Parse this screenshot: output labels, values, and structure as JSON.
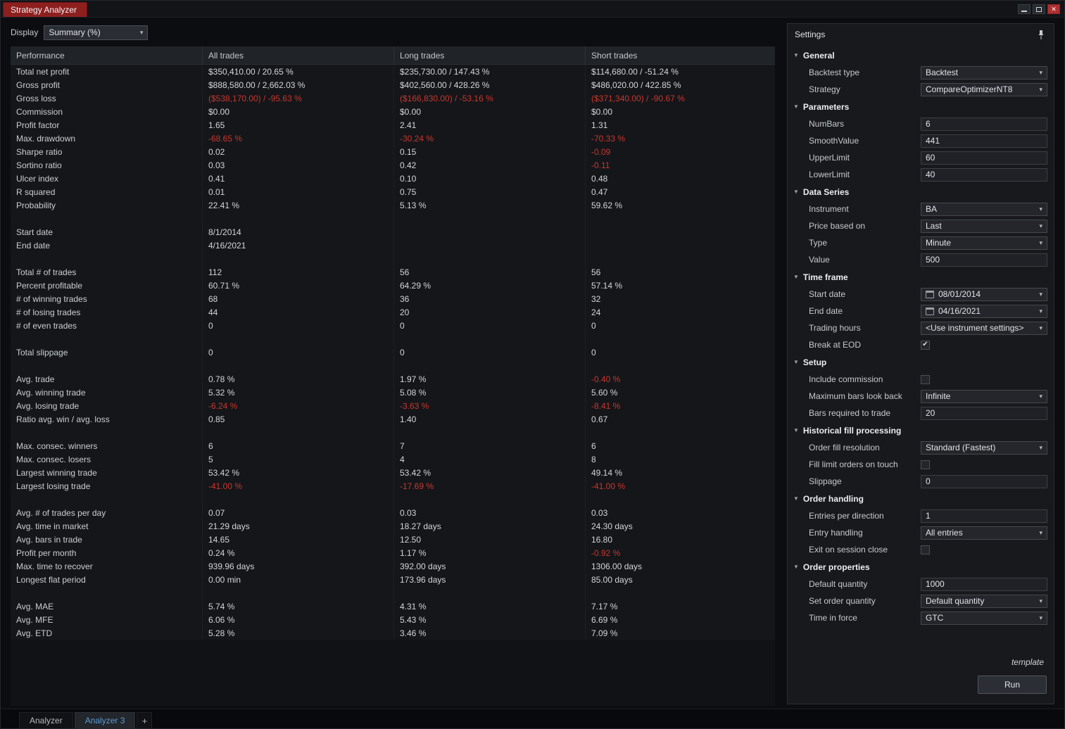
{
  "window": {
    "title": "Strategy Analyzer"
  },
  "icons": {
    "close": "✕",
    "dropdown_arrow": "▾",
    "section_expanded": "▼",
    "checkbox_check": "✔"
  },
  "toolbar": {
    "display_label": "Display",
    "display_value": "Summary (%)"
  },
  "table": {
    "columns": [
      "Performance",
      "All trades",
      "Long trades",
      "Short trades"
    ],
    "rows": [
      {
        "label": "Total net profit",
        "values": [
          "$350,410.00 / 20.65 %",
          "$235,730.00 / 147.43 %",
          "$114,680.00 / -51.24 %"
        ]
      },
      {
        "label": "Gross profit",
        "values": [
          "$888,580.00 / 2,662.03 %",
          "$402,560.00 / 428.26 %",
          "$486,020.00 / 422.85 %"
        ]
      },
      {
        "label": "Gross loss",
        "values": [
          "($538,170.00) / -95.63 %",
          "($166,830.00) / -53.16 %",
          "($371,340.00) / -90.67 %"
        ],
        "red": [
          true,
          true,
          true
        ]
      },
      {
        "label": "Commission",
        "values": [
          "$0.00",
          "$0.00",
          "$0.00"
        ]
      },
      {
        "label": "Profit factor",
        "values": [
          "1.65",
          "2.41",
          "1.31"
        ]
      },
      {
        "label": "Max. drawdown",
        "values": [
          "-68.65 %",
          "-30.24 %",
          "-70.33 %"
        ],
        "red": [
          true,
          true,
          true
        ]
      },
      {
        "label": "Sharpe ratio",
        "values": [
          "0.02",
          "0.15",
          "-0.09"
        ],
        "red": [
          false,
          false,
          true
        ]
      },
      {
        "label": "Sortino ratio",
        "values": [
          "0.03",
          "0.42",
          "-0.11"
        ],
        "red": [
          false,
          false,
          true
        ]
      },
      {
        "label": "Ulcer index",
        "values": [
          "0.41",
          "0.10",
          "0.48"
        ]
      },
      {
        "label": "R squared",
        "values": [
          "0.01",
          "0.75",
          "0.47"
        ]
      },
      {
        "label": "Probability",
        "values": [
          "22.41 %",
          "5.13 %",
          "59.62 %"
        ]
      },
      {
        "spacer": true
      },
      {
        "label": "Start date",
        "values": [
          "8/1/2014",
          "",
          ""
        ]
      },
      {
        "label": "End date",
        "values": [
          "4/16/2021",
          "",
          ""
        ]
      },
      {
        "spacer": true
      },
      {
        "label": "Total # of trades",
        "values": [
          "112",
          "56",
          "56"
        ]
      },
      {
        "label": "Percent profitable",
        "values": [
          "60.71 %",
          "64.29 %",
          "57.14 %"
        ]
      },
      {
        "label": "# of winning trades",
        "values": [
          "68",
          "36",
          "32"
        ]
      },
      {
        "label": "# of losing trades",
        "values": [
          "44",
          "20",
          "24"
        ]
      },
      {
        "label": "# of even trades",
        "values": [
          "0",
          "0",
          "0"
        ]
      },
      {
        "spacer": true
      },
      {
        "label": "Total slippage",
        "values": [
          "0",
          "0",
          "0"
        ]
      },
      {
        "spacer": true
      },
      {
        "label": "Avg. trade",
        "values": [
          "0.78 %",
          "1.97 %",
          "-0.40 %"
        ],
        "red": [
          false,
          false,
          true
        ]
      },
      {
        "label": "Avg. winning trade",
        "values": [
          "5.32 %",
          "5.08 %",
          "5.60 %"
        ]
      },
      {
        "label": "Avg. losing trade",
        "values": [
          "-6.24 %",
          "-3.63 %",
          "-8.41 %"
        ],
        "red": [
          true,
          true,
          true
        ]
      },
      {
        "label": "Ratio avg. win / avg. loss",
        "values": [
          "0.85",
          "1.40",
          "0.67"
        ]
      },
      {
        "spacer": true
      },
      {
        "label": "Max. consec. winners",
        "values": [
          "6",
          "7",
          "6"
        ]
      },
      {
        "label": "Max. consec. losers",
        "values": [
          "5",
          "4",
          "8"
        ]
      },
      {
        "label": "Largest winning trade",
        "values": [
          "53.42 %",
          "53.42 %",
          "49.14 %"
        ]
      },
      {
        "label": "Largest losing trade",
        "values": [
          "-41.00 %",
          "-17.69 %",
          "-41.00 %"
        ],
        "red": [
          true,
          true,
          true
        ]
      },
      {
        "spacer": true
      },
      {
        "label": "Avg. # of trades per day",
        "values": [
          "0.07",
          "0.03",
          "0.03"
        ]
      },
      {
        "label": "Avg. time in market",
        "values": [
          "21.29 days",
          "18.27 days",
          "24.30 days"
        ]
      },
      {
        "label": "Avg. bars in trade",
        "values": [
          "14.65",
          "12.50",
          "16.80"
        ]
      },
      {
        "label": "Profit per month",
        "values": [
          "0.24 %",
          "1.17 %",
          "-0.92 %"
        ],
        "red": [
          false,
          false,
          true
        ]
      },
      {
        "label": "Max. time to recover",
        "values": [
          "939.96 days",
          "392.00 days",
          "1306.00 days"
        ]
      },
      {
        "label": "Longest flat period",
        "values": [
          "0.00 min",
          "173.96 days",
          "85.00 days"
        ]
      },
      {
        "spacer": true
      },
      {
        "label": "Avg. MAE",
        "values": [
          "5.74 %",
          "4.31 %",
          "7.17 %"
        ]
      },
      {
        "label": "Avg. MFE",
        "values": [
          "6.06 %",
          "5.43 %",
          "6.69 %"
        ]
      },
      {
        "label": "Avg. ETD",
        "values": [
          "5.28 %",
          "3.46 %",
          "7.09 %"
        ]
      }
    ]
  },
  "settings": {
    "title": "Settings",
    "template_label": "template",
    "run_label": "Run",
    "sections": [
      {
        "title": "General",
        "rows": [
          {
            "label": "Backtest type",
            "type": "dropdown",
            "value": "Backtest"
          },
          {
            "label": "Strategy",
            "type": "dropdown",
            "value": "CompareOptimizerNT8"
          }
        ]
      },
      {
        "title": "Parameters",
        "rows": [
          {
            "label": "NumBars",
            "type": "input",
            "value": "6"
          },
          {
            "label": "SmoothValue",
            "type": "input",
            "value": "441"
          },
          {
            "label": "UpperLimit",
            "type": "input",
            "value": "60"
          },
          {
            "label": "LowerLimit",
            "type": "input",
            "value": "40"
          }
        ]
      },
      {
        "title": "Data Series",
        "rows": [
          {
            "label": "Instrument",
            "type": "dropdown",
            "value": "BA"
          },
          {
            "label": "Price based on",
            "type": "dropdown",
            "value": "Last"
          },
          {
            "label": "Type",
            "type": "dropdown",
            "value": "Minute"
          },
          {
            "label": "Value",
            "type": "input",
            "value": "500"
          }
        ]
      },
      {
        "title": "Time frame",
        "rows": [
          {
            "label": "Start date",
            "type": "date",
            "value": "08/01/2014"
          },
          {
            "label": "End date",
            "type": "date",
            "value": "04/16/2021"
          },
          {
            "label": "Trading hours",
            "type": "dropdown",
            "value": "<Use instrument settings>"
          },
          {
            "label": "Break at EOD",
            "type": "checkbox",
            "checked": true
          }
        ]
      },
      {
        "title": "Setup",
        "rows": [
          {
            "label": "Include commission",
            "type": "checkbox",
            "checked": false
          },
          {
            "label": "Maximum bars look back",
            "type": "dropdown",
            "value": "Infinite"
          },
          {
            "label": "Bars required to trade",
            "type": "input",
            "value": "20"
          }
        ]
      },
      {
        "title": "Historical fill processing",
        "rows": [
          {
            "label": "Order fill resolution",
            "type": "dropdown",
            "value": "Standard (Fastest)"
          },
          {
            "label": "Fill limit orders on touch",
            "type": "checkbox",
            "checked": false
          },
          {
            "label": "Slippage",
            "type": "input",
            "value": "0"
          }
        ]
      },
      {
        "title": "Order handling",
        "rows": [
          {
            "label": "Entries per direction",
            "type": "input",
            "value": "1"
          },
          {
            "label": "Entry handling",
            "type": "dropdown",
            "value": "All entries"
          },
          {
            "label": "Exit on session close",
            "type": "checkbox",
            "checked": false
          }
        ]
      },
      {
        "title": "Order properties",
        "rows": [
          {
            "label": "Default quantity",
            "type": "input",
            "value": "1000"
          },
          {
            "label": "Set order quantity",
            "type": "dropdown",
            "value": "Default quantity"
          },
          {
            "label": "Time in force",
            "type": "dropdown",
            "value": "GTC"
          }
        ]
      }
    ]
  },
  "tabs": [
    {
      "label": "Analyzer",
      "active": false
    },
    {
      "label": "Analyzer 3",
      "active": true
    }
  ],
  "add_tab_label": "+"
}
